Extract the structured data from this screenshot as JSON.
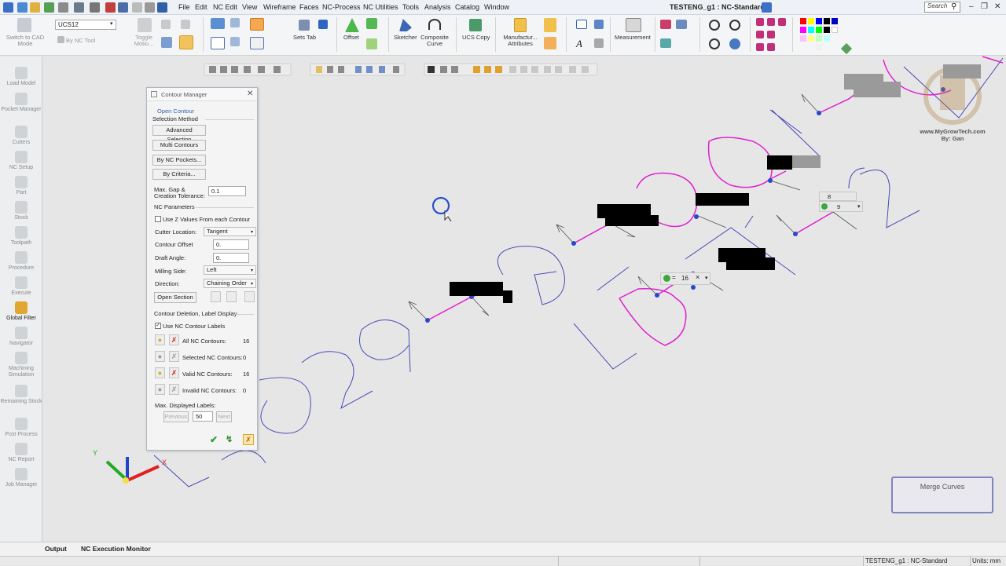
{
  "menubar": {
    "items": [
      "File",
      "Edit",
      "NC Edit",
      "View",
      "Wireframe",
      "Faces",
      "NC-Process",
      "NC Utilities",
      "Tools",
      "Analysis",
      "Catalog",
      "Window"
    ],
    "title": "TESTENG_g1 : NC-Standard",
    "search_placeholder": "Search"
  },
  "ribbon": {
    "switch_cad": "Switch to CAD Mode",
    "ucs_value": "UCS12",
    "by_nc_tool": "By NC Tool",
    "toggle_motion": "Toggle Motio...",
    "sets_tab": "Sets Tab",
    "offset": "Offset",
    "sketcher": "Sketcher",
    "composite_curve": "Composite Curve",
    "ucs_copy": "UCS Copy",
    "manufacturing_attributes": "Manufactur... Attributes",
    "measurement": "Measurement"
  },
  "left_panel": {
    "items": [
      "Load Model",
      "Pocket Manager",
      "Cutters",
      "NC Setup",
      "Part",
      "Stock",
      "Toolpath",
      "Procedure",
      "Execute",
      "Global Filter",
      "Navigator",
      "Machining Simulation",
      "Remaining Stock",
      "Post Process",
      "NC Report",
      "Job Manager"
    ]
  },
  "contour_manager": {
    "title": "Contour Manager",
    "open_contour": "Open Contour",
    "selection_method": "Selection Method",
    "advanced_selection": "Advanced Selection",
    "multi_contours": "Multi Contours",
    "by_nc_pockets": "By NC Pockets...",
    "by_criteria": "By Criteria...",
    "max_gap_label": "Max. Gap &",
    "creation_tolerance_label": "Creation Tolerance:",
    "max_gap_value": "0.1",
    "nc_parameters": "NC Parameters",
    "use_z_values": "Use Z Values From each Contour",
    "cutter_location_label": "Cutter Location:",
    "cutter_location_value": "Tangent",
    "contour_offset_label": "Contour Offset",
    "contour_offset_value": "0.",
    "draft_angle_label": "Draft Angle:",
    "draft_angle_value": "0.",
    "milling_side_label": "Milling Side:",
    "milling_side_value": "Left",
    "direction_label": "Direction:",
    "direction_value": "Chaining Order",
    "open_section": "Open Section",
    "deletion_label_display": "Contour Deletion, Label Display",
    "use_nc_contour_labels": "Use NC Contour Labels",
    "all_nc_contours_label": "All NC Contours:",
    "all_nc_contours_value": "16",
    "selected_nc_contours_label": "Selected NC Contours:",
    "selected_nc_contours_value": "0",
    "valid_nc_contours_label": "Valid NC Contours:",
    "valid_nc_contours_value": "16",
    "invalid_nc_contours_label": "Invalid NC Contours:",
    "invalid_nc_contours_value": "0",
    "max_displayed_labels": "Max. Displayed Labels:",
    "previous": "Previous",
    "max_labels_value": "50",
    "next": "Next"
  },
  "viewport": {
    "label_16": "16",
    "label_8": "8",
    "label_9": "9",
    "merge_curves": "Merge Curves",
    "watermark_site": "www.MyGrowTech.com",
    "watermark_by": "By: Gan",
    "axis_y": "Y",
    "axis_x": "X"
  },
  "bottom_tabs": [
    "Output",
    "NC Execution Monitor"
  ],
  "status": {
    "file": "TESTENG_g1 : NC-Standard",
    "units": "Units: mm"
  },
  "colors": {
    "contour": "#e020d0",
    "wire": "#4040b0",
    "accent": "#2d5fb0"
  }
}
